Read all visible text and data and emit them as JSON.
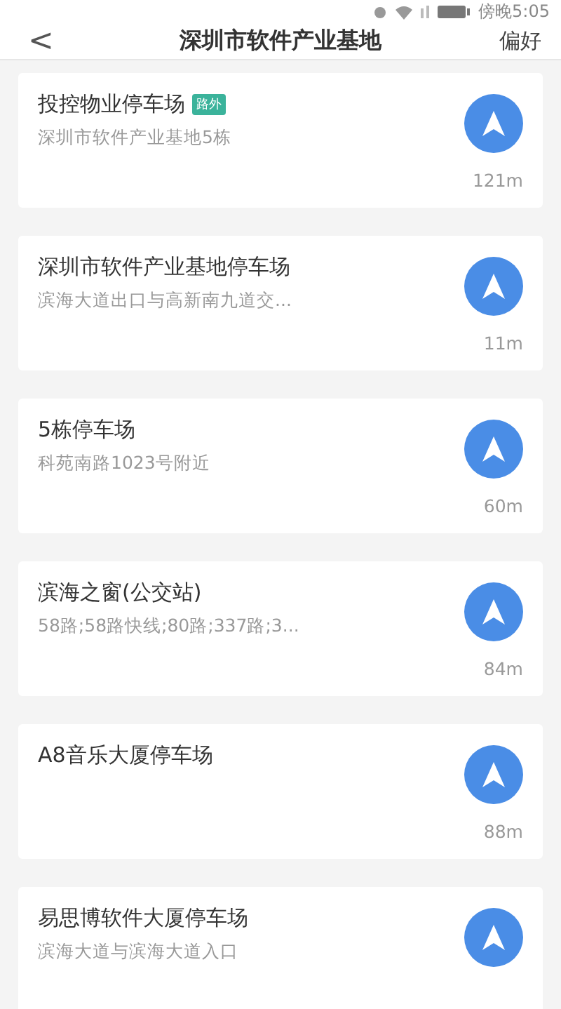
{
  "status_bar": {
    "time": "傍晚5:05"
  },
  "header": {
    "back": "<",
    "title": "深圳市软件产业基地",
    "action": "偏好"
  },
  "places": [
    {
      "name": "投控物业停车场",
      "tag": "路外",
      "address": "深圳市软件产业基地5栋",
      "distance": "121m"
    },
    {
      "name": "深圳市软件产业基地停车场",
      "address": "滨海大道出口与高新南九道交...",
      "distance": "11m"
    },
    {
      "name": "5栋停车场",
      "address": "科苑南路1023号附近",
      "distance": "60m"
    },
    {
      "name": "滨海之窗(公交站)",
      "address": "58路;58路快线;80路;337路;3...",
      "distance": "84m"
    },
    {
      "name": "A8音乐大厦停车场",
      "distance": "88m"
    },
    {
      "name": "易思博软件大厦停车场",
      "address": "滨海大道与滨海大道入口"
    }
  ]
}
